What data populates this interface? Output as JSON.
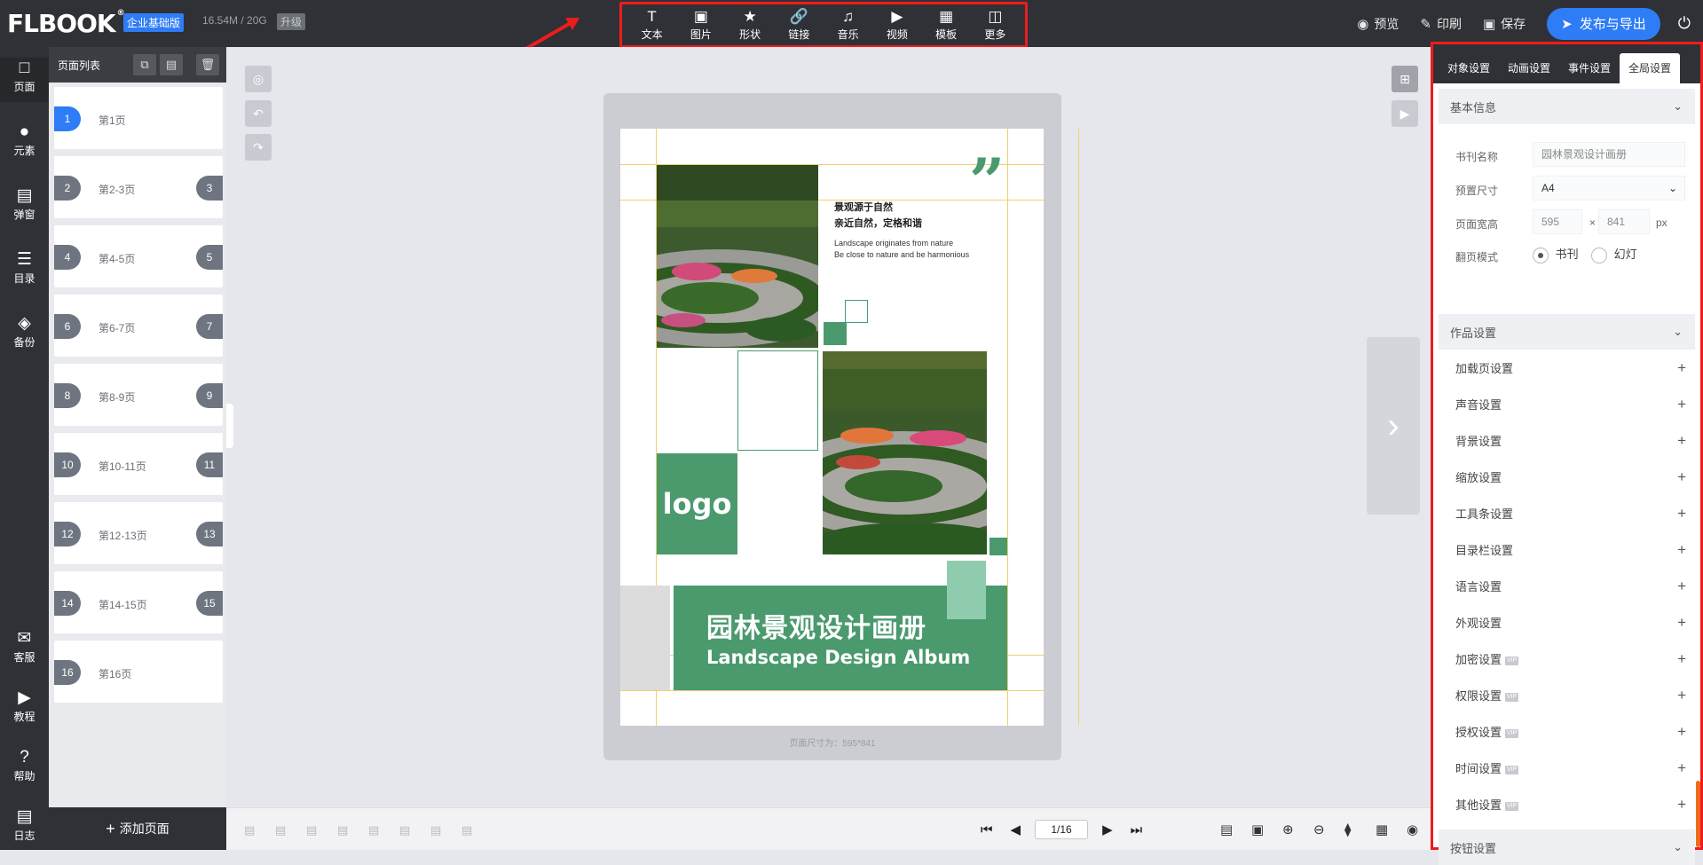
{
  "app": {
    "logo": "FLBOOK",
    "logo_mark": "®",
    "edition": "企业基础版",
    "storage": "16.54M / 20G",
    "upgrade": "升级"
  },
  "toolbar": [
    {
      "label": "文本",
      "icon": "text-icon"
    },
    {
      "label": "图片",
      "icon": "image-icon"
    },
    {
      "label": "形状",
      "icon": "star-icon"
    },
    {
      "label": "链接",
      "icon": "link-icon"
    },
    {
      "label": "音乐",
      "icon": "music-icon"
    },
    {
      "label": "视频",
      "icon": "video-icon"
    },
    {
      "label": "模板",
      "icon": "template-icon"
    },
    {
      "label": "更多",
      "icon": "more-icon"
    }
  ],
  "actions": {
    "preview": "预览",
    "print": "印刷",
    "save": "保存",
    "publish": "发布与导出"
  },
  "leftnav": {
    "items": [
      {
        "label": "页面"
      },
      {
        "label": "元素"
      },
      {
        "label": "弹窗"
      },
      {
        "label": "目录"
      },
      {
        "label": "备份"
      }
    ],
    "bottom": [
      {
        "label": "客服"
      },
      {
        "label": "教程"
      },
      {
        "label": "帮助"
      },
      {
        "label": "日志"
      }
    ]
  },
  "pagelist": {
    "title": "页面列表",
    "add": "添加页面",
    "pages": [
      {
        "label": "第1页",
        "left": "1",
        "right": ""
      },
      {
        "label": "第2-3页",
        "left": "2",
        "right": "3"
      },
      {
        "label": "第4-5页",
        "left": "4",
        "right": "5"
      },
      {
        "label": "第6-7页",
        "left": "6",
        "right": "7"
      },
      {
        "label": "第8-9页",
        "left": "8",
        "right": "9"
      },
      {
        "label": "第10-11页",
        "left": "10",
        "right": "11"
      },
      {
        "label": "第12-13页",
        "left": "12",
        "right": "13"
      },
      {
        "label": "第14-15页",
        "left": "14",
        "right": "15"
      },
      {
        "label": "第16页",
        "left": "16",
        "right": ""
      }
    ]
  },
  "canvas": {
    "title_cn": "园林景观设计画册",
    "title_en": "Landscape Design Album",
    "logo": "logo",
    "tag_line1": "景观源于自然",
    "tag_line2": "亲近自然，定格和谐",
    "tag_en1": "Landscape originates from nature",
    "tag_en2": "Be close to nature and be harmonious",
    "size_note": "页面尺寸为：595*841",
    "accent": "#4a9a6e"
  },
  "pager": {
    "current": "1/16"
  },
  "rightpanel": {
    "tabs": [
      "对象设置",
      "动画设置",
      "事件设置",
      "全局设置"
    ],
    "basic": {
      "title": "基本信息",
      "name_label": "书刊名称",
      "name_value": "园林景观设计画册",
      "size_label": "预置尺寸",
      "size_value": "A4",
      "wh_label": "页面宽高",
      "width": "595",
      "x": "×",
      "height": "841",
      "unit": "px",
      "mode_label": "翻页模式",
      "mode_book": "书刊",
      "mode_slide": "幻灯"
    },
    "work_title": "作品设置",
    "settings": [
      {
        "label": "加载页设置",
        "vip": ""
      },
      {
        "label": "声音设置",
        "vip": ""
      },
      {
        "label": "背景设置",
        "vip": ""
      },
      {
        "label": "缩放设置",
        "vip": ""
      },
      {
        "label": "工具条设置",
        "vip": ""
      },
      {
        "label": "目录栏设置",
        "vip": ""
      },
      {
        "label": "语言设置",
        "vip": ""
      },
      {
        "label": "外观设置",
        "vip": ""
      },
      {
        "label": "加密设置",
        "vip": "VIP"
      },
      {
        "label": "权限设置",
        "vip": "VIP"
      },
      {
        "label": "授权设置",
        "vip": "VIP"
      },
      {
        "label": "时间设置",
        "vip": "VIP"
      },
      {
        "label": "其他设置",
        "vip": "VIP"
      }
    ],
    "button_title": "按钮设置"
  }
}
